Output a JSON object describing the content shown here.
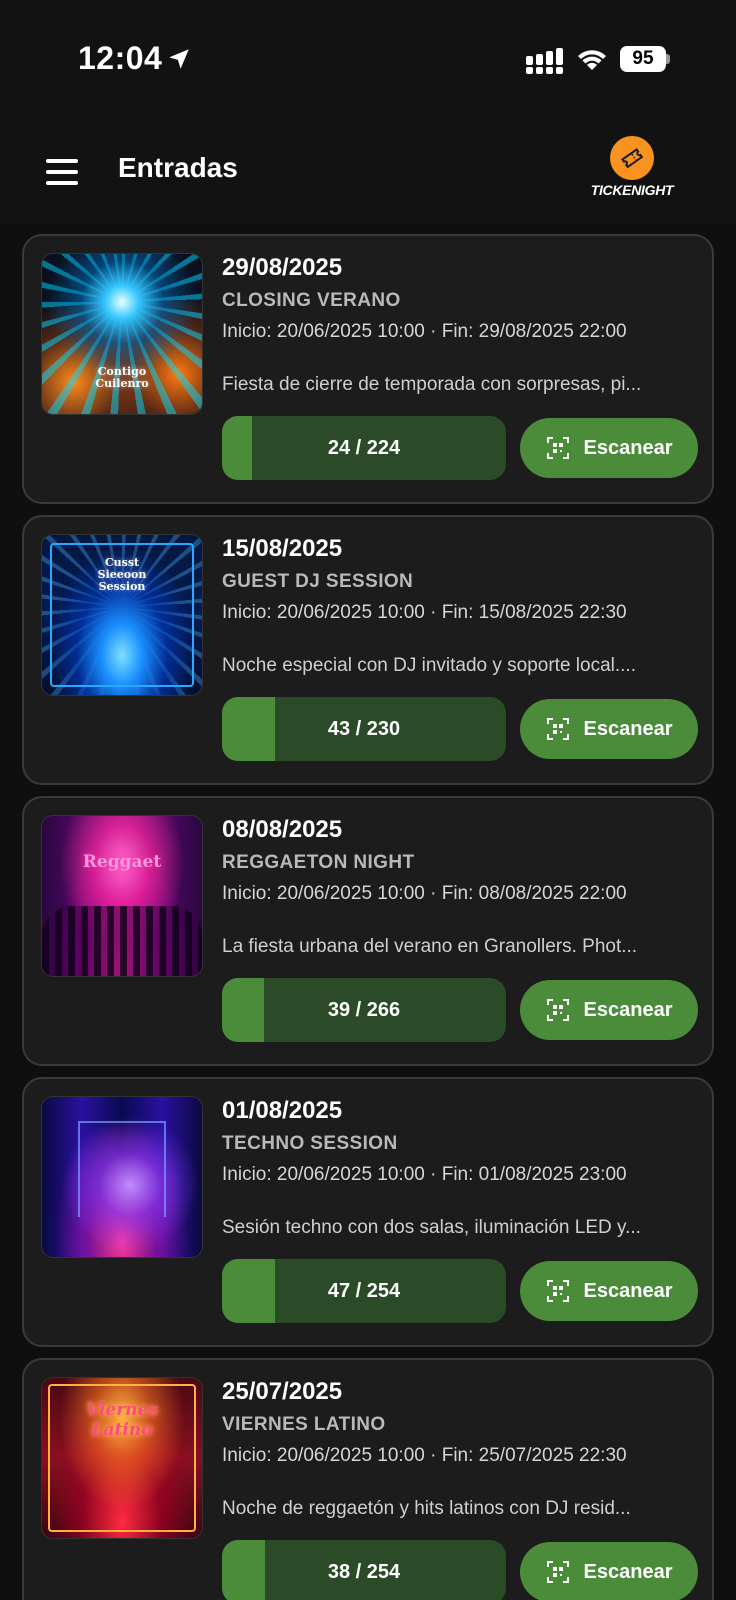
{
  "status_bar": {
    "time": "12:04",
    "battery": "95"
  },
  "header": {
    "title": "Entradas",
    "brand": "TICKENIGHT"
  },
  "events": [
    {
      "date": "29/08/2025",
      "name": "CLOSING VERANO",
      "times": "Inicio: 20/06/2025 10:00  ·  Fin: 29/08/2025 22:00",
      "description": "Fiesta de cierre de temporada con sorpresas, pi...",
      "capacity": "24 / 224",
      "fill": 0.107,
      "scan_label": "Escanear",
      "image_text": "Contigo Cuilenro"
    },
    {
      "date": "15/08/2025",
      "name": "GUEST DJ SESSION",
      "times": "Inicio: 20/06/2025 10:00  ·  Fin: 15/08/2025 22:30",
      "description": "Noche especial con DJ invitado y soporte local....",
      "capacity": "43 / 230",
      "fill": 0.187,
      "scan_label": "Escanear",
      "image_text": "Cusst Sieeoon Session"
    },
    {
      "date": "08/08/2025",
      "name": "REGGAETON NIGHT",
      "times": "Inicio: 20/06/2025 10:00  ·  Fin: 08/08/2025 22:00",
      "description": "La fiesta urbana del verano en Granollers. Phot...",
      "capacity": "39 / 266",
      "fill": 0.147,
      "scan_label": "Escanear",
      "image_text": "Reggaet"
    },
    {
      "date": "01/08/2025",
      "name": "TECHNO SESSION",
      "times": "Inicio: 20/06/2025 10:00  ·  Fin: 01/08/2025 23:00",
      "description": "Sesión techno con dos salas, iluminación LED y...",
      "capacity": "47 / 254",
      "fill": 0.185,
      "scan_label": "Escanear",
      "image_text": ""
    },
    {
      "date": "25/07/2025",
      "name": "VIERNES LATINO",
      "times": "Inicio: 20/06/2025 10:00  ·  Fin: 25/07/2025 22:30",
      "description": "Noche de reggaetón y hits latinos con DJ resid...",
      "capacity": "38 / 254",
      "fill": 0.15,
      "scan_label": "Escanear",
      "image_text": "Viernes Latino"
    }
  ],
  "colors": {
    "accent_green": "#4a8c39",
    "bar_track": "#2a4a28",
    "brand_orange": "#f7931e",
    "card_bg": "#1c1c1c"
  },
  "icons": {
    "location": "location-arrow-icon",
    "signal": "cellular-signal-icon",
    "wifi": "wifi-icon",
    "menu": "hamburger-menu-icon",
    "qr": "qr-scan-icon",
    "brand": "ticket-logo-icon"
  }
}
